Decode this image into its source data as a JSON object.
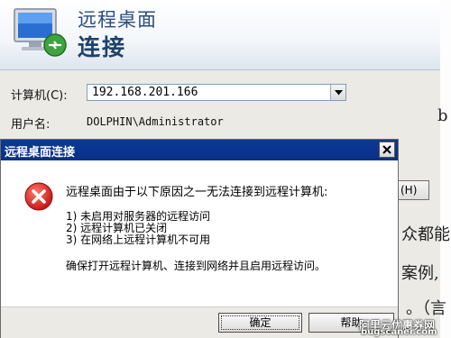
{
  "rdc_window": {
    "title_line1": "远程桌面",
    "title_line2": "连接",
    "computer_label": "计算机(C):",
    "computer_value": "192.168.201.166",
    "username_label": "用户名:",
    "username_value": "DOLPHIN\\Administrator",
    "partial_button": "(H)"
  },
  "background_text": {
    "frag1": "b",
    "frag2": "众都能",
    "frag3": "案例,",
    "frag4": "。（言"
  },
  "dialog": {
    "title": "远程桌面连接",
    "message": "远程桌面由于以下原因之一无法连接到远程计算机:",
    "reasons": [
      "1) 未启用对服务器的远程访问",
      "2) 远程计算机已关闭",
      "3) 在网络上远程计算机不可用"
    ],
    "advice": "确保打开远程计算机、连接到网络并且启用远程访问。",
    "ok_label": "确定",
    "help_label": "帮助"
  },
  "watermark": {
    "line1": "阿里云优惠券网",
    "line2": "bugscaner.com"
  },
  "colors": {
    "titlebar": "#0a3a97",
    "error_red": "#d32020"
  }
}
